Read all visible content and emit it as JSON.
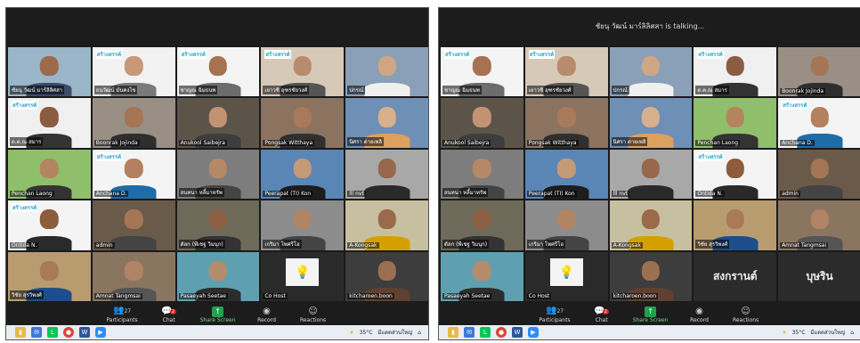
{
  "left": {
    "talking": "",
    "tiles": [
      {
        "name": "ชัยนุ วัฒน์ มาร์ลิลิศสา",
        "logo": "",
        "active": true,
        "bg": "#9bb6c8",
        "skin": "#9c6b4c",
        "shirt": "#3c4c6c"
      },
      {
        "name": "ธนวัฒน์ มั่นคงไข",
        "logo": "สร้างสรรค์",
        "bg": "#f2f2f2",
        "skin": "#c89878",
        "shirt": "#7a7a7a"
      },
      {
        "name": "ชาญณ ฉิมธนพ",
        "logo": "สร้างสรรค์",
        "bg": "#f4f4f4",
        "skin": "#a77252",
        "shirt": "#6c6c6c"
      },
      {
        "name": "เยาวชิ อุฑรชัยวงศ์",
        "logo": "สร้างสรรค์",
        "bg": "#d7c9b8",
        "skin": "#b98b6d",
        "shirt": "#555"
      },
      {
        "name": "ปกรณ์",
        "logo": "",
        "bg": "#8aa0b8",
        "skin": "#d1a684",
        "shirt": "#f0f0f0"
      },
      {
        "name": "ด.ต.ณ สมาร",
        "logo": "สร้างสรรค์",
        "bg": "#f0f0f0",
        "skin": "#8a5c42",
        "shirt": "#333"
      },
      {
        "name": "Boonrak Jojinda",
        "logo": "",
        "bg": "#9a8f85",
        "skin": "#a47656",
        "shirt": "#2e2e2e"
      },
      {
        "name": "Anukool Saibejra",
        "logo": "",
        "bg": "#5d5449",
        "skin": "#c29373",
        "shirt": "#3d3d3d"
      },
      {
        "name": "Pongsak Witthaya",
        "logo": "",
        "bg": "#8b7360",
        "skin": "#a9795b",
        "shirt": "#2f2f2f"
      },
      {
        "name": "นิศรา ต่ายเพลิ",
        "logo": "",
        "bg": "#6e8fb6",
        "skin": "#d7b08d",
        "shirt": "#dca060"
      },
      {
        "name": "Penchan Laong",
        "logo": "",
        "bg": "#8fbf6a",
        "skin": "#b3855f",
        "shirt": "#333"
      },
      {
        "name": "Anchana D.",
        "logo": "สร้างสรรค์",
        "bg": "#f4f4f4",
        "skin": "#b4805f",
        "shirt": "#1e6ca8"
      },
      {
        "name": "สนทนา หลี้มาทรัพ",
        "logo": "",
        "bg": "#7d7d7d",
        "skin": "#b58868",
        "shirt": "#444"
      },
      {
        "name": "Peerapat (TI) Kon",
        "logo": "",
        "bg": "#5a86b5",
        "skin": "#c49a77",
        "shirt": "#1d1d1d"
      },
      {
        "name": "lll nvt",
        "logo": "",
        "bg": "#a8a8a8",
        "skin": "#97684b",
        "shirt": "#2a2a2a"
      },
      {
        "name": "Ontida N.",
        "logo": "สร้างสรรค์",
        "bg": "#f4f4f4",
        "skin": "#8b5d3d",
        "shirt": "#2a2a2a"
      },
      {
        "name": "admin",
        "logo": "",
        "bg": "#6a5a4a",
        "skin": "#a57656",
        "shirt": "#444"
      },
      {
        "name": "ดัลก (พีเชฐ วิมนุก)",
        "logo": "",
        "bg": "#6e6a5a",
        "skin": "#8c5e42",
        "shirt": "#333"
      },
      {
        "name": "เกริมา โพศรีโฮ",
        "logo": "",
        "bg": "#8c8c8c",
        "skin": "#b18463",
        "shirt": "#444"
      },
      {
        "name": "A-Kongsak",
        "logo": "",
        "bg": "#c7c0a0",
        "skin": "#9a6a4a",
        "shirt": "#d4a000"
      },
      {
        "name": "วิชัย สุรวิพงศ์",
        "logo": "",
        "bg": "#b89c70",
        "skin": "#a97a58",
        "shirt": "#1e4e8a"
      },
      {
        "name": "Amnat Tangmsai",
        "logo": "",
        "bg": "#8a7560",
        "skin": "#b08464",
        "shirt": "#555"
      },
      {
        "name": "Pasaeyah Seetae",
        "logo": "",
        "bg": "#5ea0b0",
        "skin": "#b48c6c",
        "shirt": "#2c2c2c"
      },
      {
        "name": "Co Host",
        "logo": "",
        "bulb": true,
        "bg": "#2a2a2a"
      },
      {
        "name": "kitcharoen.boon",
        "logo": "",
        "bg": "#3d3d3d",
        "skin": "#9b7050",
        "shirt": "#604030"
      }
    ]
  },
  "right": {
    "talking": "ชัยนุ วัฒน์ มาร์ลิลิศสา is talking...",
    "tiles": [
      {
        "name": "ชาญณ ฉิมธนพ",
        "logo": "สร้างสรรค์",
        "bg": "#f4f4f4",
        "skin": "#a77252",
        "shirt": "#6c6c6c"
      },
      {
        "name": "เยาวชิ อุฑรชัยวงศ์",
        "logo": "สร้างสรรค์",
        "bg": "#d7c9b8",
        "skin": "#b98b6d",
        "shirt": "#555"
      },
      {
        "name": "ปกรณ์",
        "logo": "",
        "bg": "#8aa0b8",
        "skin": "#d1a684",
        "shirt": "#f0f0f0"
      },
      {
        "name": "ด.ต.ณ สมาร",
        "logo": "สร้างสรรค์",
        "bg": "#f0f0f0",
        "skin": "#8a5c42",
        "shirt": "#333"
      },
      {
        "name": "Boonrak Jojinda",
        "logo": "",
        "bg": "#9a8f85",
        "skin": "#a47656",
        "shirt": "#2e2e2e"
      },
      {
        "name": "Anukool Saibejra",
        "logo": "",
        "bg": "#5d5449",
        "skin": "#c29373",
        "shirt": "#3d3d3d"
      },
      {
        "name": "Pongsak Witthaya",
        "logo": "",
        "bg": "#8b7360",
        "skin": "#a9795b",
        "shirt": "#2f2f2f"
      },
      {
        "name": "นิศรา ต่ายเพลิ",
        "logo": "",
        "bg": "#6e8fb6",
        "skin": "#d7b08d",
        "shirt": "#dca060"
      },
      {
        "name": "Penchan Laong",
        "logo": "",
        "bg": "#8fbf6a",
        "skin": "#b3855f",
        "shirt": "#333"
      },
      {
        "name": "Anchana D.",
        "logo": "สร้างสรรค์",
        "bg": "#f4f4f4",
        "skin": "#b4805f",
        "shirt": "#1e6ca8"
      },
      {
        "name": "สนทนา หลี้มาทรัพ",
        "logo": "",
        "bg": "#7d7d7d",
        "skin": "#b58868",
        "shirt": "#444"
      },
      {
        "name": "Peerapat (TI) Kon",
        "logo": "",
        "bg": "#5a86b5",
        "skin": "#c49a77",
        "shirt": "#1d1d1d"
      },
      {
        "name": "lll nvt",
        "logo": "",
        "bg": "#a8a8a8",
        "skin": "#97684b",
        "shirt": "#2a2a2a"
      },
      {
        "name": "Ontida N.",
        "logo": "สร้างสรรค์",
        "bg": "#f4f4f4",
        "skin": "#8b5d3d",
        "shirt": "#2a2a2a"
      },
      {
        "name": "admin",
        "logo": "",
        "bg": "#6a5a4a",
        "skin": "#a57656",
        "shirt": "#444"
      },
      {
        "name": "ดัลก (พีเชฐ วิมนุก)",
        "logo": "",
        "bg": "#6e6a5a",
        "skin": "#8c5e42",
        "shirt": "#333"
      },
      {
        "name": "เกริมา โพศรีโฮ",
        "logo": "",
        "bg": "#8c8c8c",
        "skin": "#b18463",
        "shirt": "#444"
      },
      {
        "name": "A-Kongsak",
        "logo": "",
        "bg": "#c7c0a0",
        "skin": "#9a6a4a",
        "shirt": "#d4a000"
      },
      {
        "name": "วิชัย สุรวิพงศ์",
        "logo": "",
        "bg": "#b89c70",
        "skin": "#a97a58",
        "shirt": "#1e4e8a"
      },
      {
        "name": "Amnat Tangmsai",
        "logo": "",
        "bg": "#8a7560",
        "skin": "#b08464",
        "shirt": "#555"
      },
      {
        "name": "Pasaeyah Seetae",
        "logo": "",
        "bg": "#5ea0b0",
        "skin": "#b48c6c",
        "shirt": "#2c2c2c"
      },
      {
        "name": "Co Host",
        "logo": "",
        "bulb": true,
        "bg": "#2a2a2a"
      },
      {
        "name": "kitcharoen.boon",
        "logo": "",
        "bg": "#3d3d3d",
        "skin": "#9b7050",
        "shirt": "#604030"
      },
      {
        "name": "",
        "big": "สงกรานต์",
        "bg": "#2b2b2b"
      },
      {
        "name": "",
        "big": "บุษริน",
        "bg": "#2b2b2b"
      }
    ]
  },
  "toolbar": {
    "participants_label": "Participants",
    "participants_count": "27",
    "chat_label": "Chat",
    "chat_badge": "2",
    "share_label": "Share Screen",
    "record_label": "Record",
    "reactions_label": "Reactions"
  },
  "taskbar": {
    "weather": "35°C",
    "weather_desc": "มีแดดส่วนใหญ่"
  }
}
